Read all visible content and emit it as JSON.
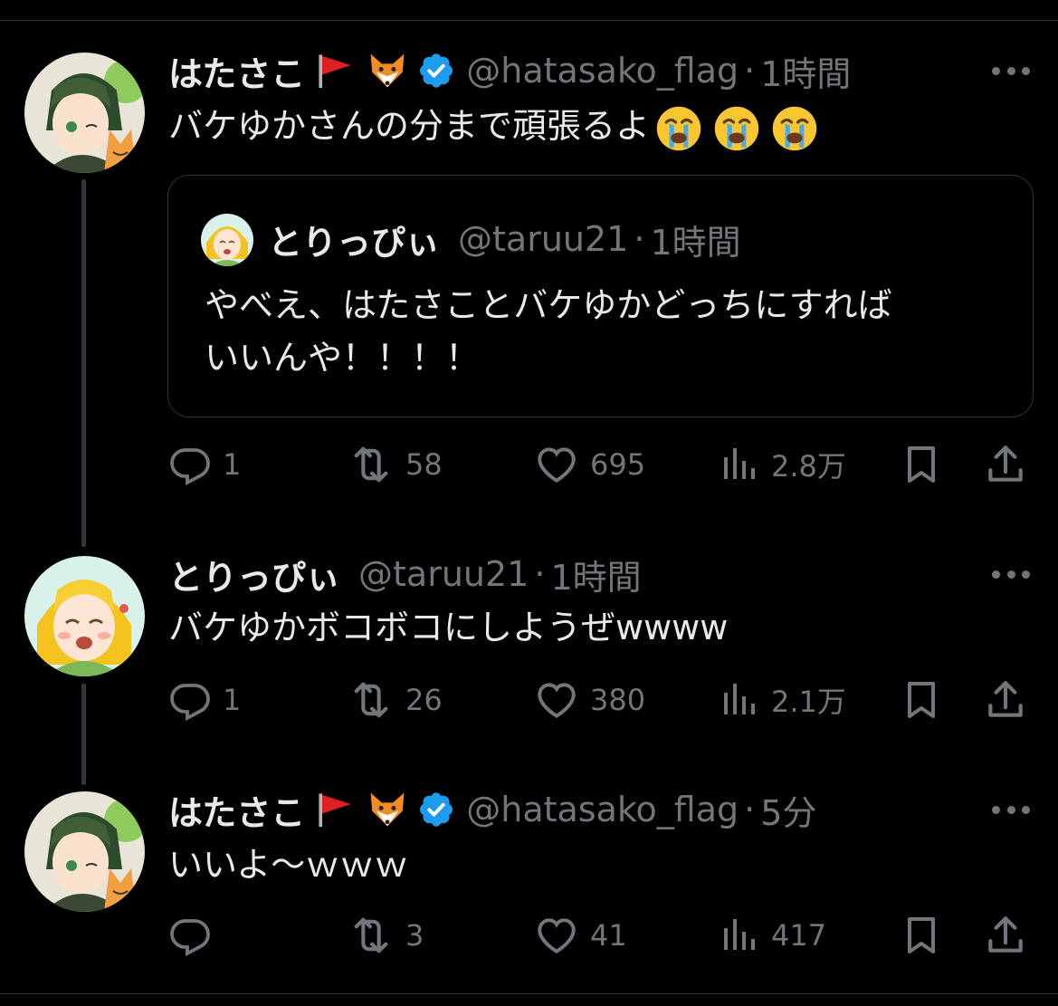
{
  "colors": {
    "background": "#000000",
    "text": "#e7e9ea",
    "muted": "#71767b",
    "border": "#2f3336",
    "verified": "#1d9bf0"
  },
  "tweets": [
    {
      "name": "はたさこ",
      "handle": "@hatasako_flag",
      "separator": "·",
      "time": "1時間",
      "verified": true,
      "text": "バケゆかさんの分まで頑張るよ",
      "emojis": [
        "loudly-crying-face",
        "loudly-crying-face",
        "loudly-crying-face"
      ],
      "quote": {
        "name": "とりっぴぃ",
        "handle": "@taruu21",
        "separator": "·",
        "time": "1時間",
        "text": "やべえ、はたさことバケゆかどっちにすれば\nいいんや！！！！"
      },
      "stats": {
        "replies": "1",
        "retweets": "58",
        "likes": "695",
        "views": "2.8万"
      }
    },
    {
      "name": "とりっぴぃ",
      "handle": "@taruu21",
      "separator": "·",
      "time": "1時間",
      "verified": false,
      "text": "バケゆかボコボコにしようぜwwww",
      "stats": {
        "replies": "1",
        "retweets": "26",
        "likes": "380",
        "views": "2.1万"
      }
    },
    {
      "name": "はたさこ",
      "handle": "@hatasako_flag",
      "separator": "·",
      "time": "5分",
      "verified": true,
      "text": "いいよ〜ｗｗｗ",
      "stats": {
        "replies": "",
        "retweets": "3",
        "likes": "41",
        "views": "417"
      }
    }
  ]
}
